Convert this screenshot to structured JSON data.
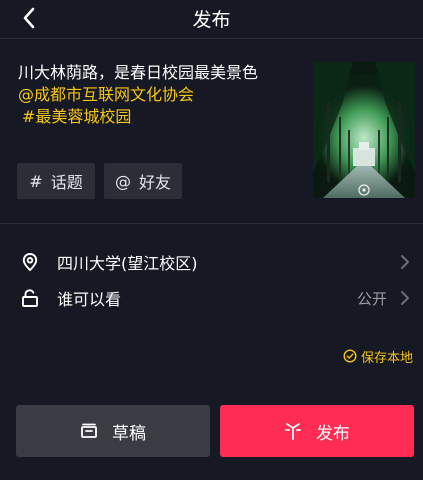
{
  "header": {
    "title": "发布",
    "back_icon": "chevron-left-icon"
  },
  "caption": {
    "text": "川大林荫路，是春日校园最美景色",
    "mention": "@成都市互联网文化协会",
    "hashtag": "#最美蓉城校园"
  },
  "cover": {
    "description_icon": "cover-thumbnail"
  },
  "chips": {
    "topic_symbol": "#",
    "topic_label": "话题",
    "friend_symbol": "@",
    "friend_label": "好友"
  },
  "location": {
    "icon": "location-pin-icon",
    "label": "四川大学(望江校区)"
  },
  "visibility": {
    "icon": "unlock-icon",
    "label": "谁可以看",
    "value": "公开"
  },
  "save_local": {
    "label": "保存本地"
  },
  "actions": {
    "draft_label": "草稿",
    "publish_label": "发布"
  },
  "colors": {
    "background": "#161823",
    "accent_yellow": "#f5c518",
    "publish_red": "#fe2c55",
    "chip_bg": "#2b2d37"
  }
}
